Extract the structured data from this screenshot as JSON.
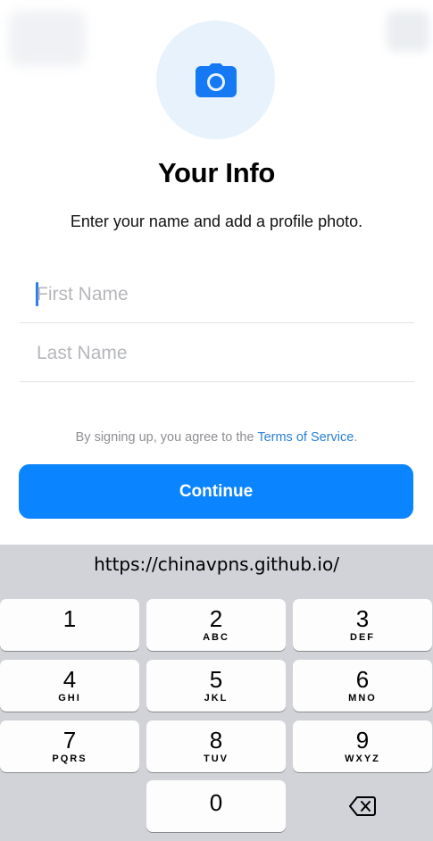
{
  "header": {
    "title": "Your Info",
    "subtitle": "Enter your name and add a profile photo."
  },
  "form": {
    "first_name": {
      "value": "",
      "placeholder": "First Name"
    },
    "last_name": {
      "value": "",
      "placeholder": "Last Name"
    }
  },
  "terms": {
    "prefix": "By signing up, you agree to the ",
    "link": "Terms of Service",
    "suffix": "."
  },
  "continue_label": "Continue",
  "keyboard": {
    "suggestion": "https://chinavpns.github.io/",
    "keys": [
      {
        "num": "1",
        "letters": ""
      },
      {
        "num": "2",
        "letters": "ABC"
      },
      {
        "num": "3",
        "letters": "DEF"
      },
      {
        "num": "4",
        "letters": "GHI"
      },
      {
        "num": "5",
        "letters": "JKL"
      },
      {
        "num": "6",
        "letters": "MNO"
      },
      {
        "num": "7",
        "letters": "PQRS"
      },
      {
        "num": "8",
        "letters": "TUV"
      },
      {
        "num": "9",
        "letters": "WXYZ"
      },
      {
        "num": "0",
        "letters": ""
      }
    ]
  },
  "icons": {
    "photo": "camera-icon",
    "delete": "backspace-icon"
  },
  "colors": {
    "accent": "#0a84ff",
    "link": "#2a7fd6",
    "avatar_bg": "#e8f2fc",
    "keyboard_bg": "#d1d3d9"
  }
}
